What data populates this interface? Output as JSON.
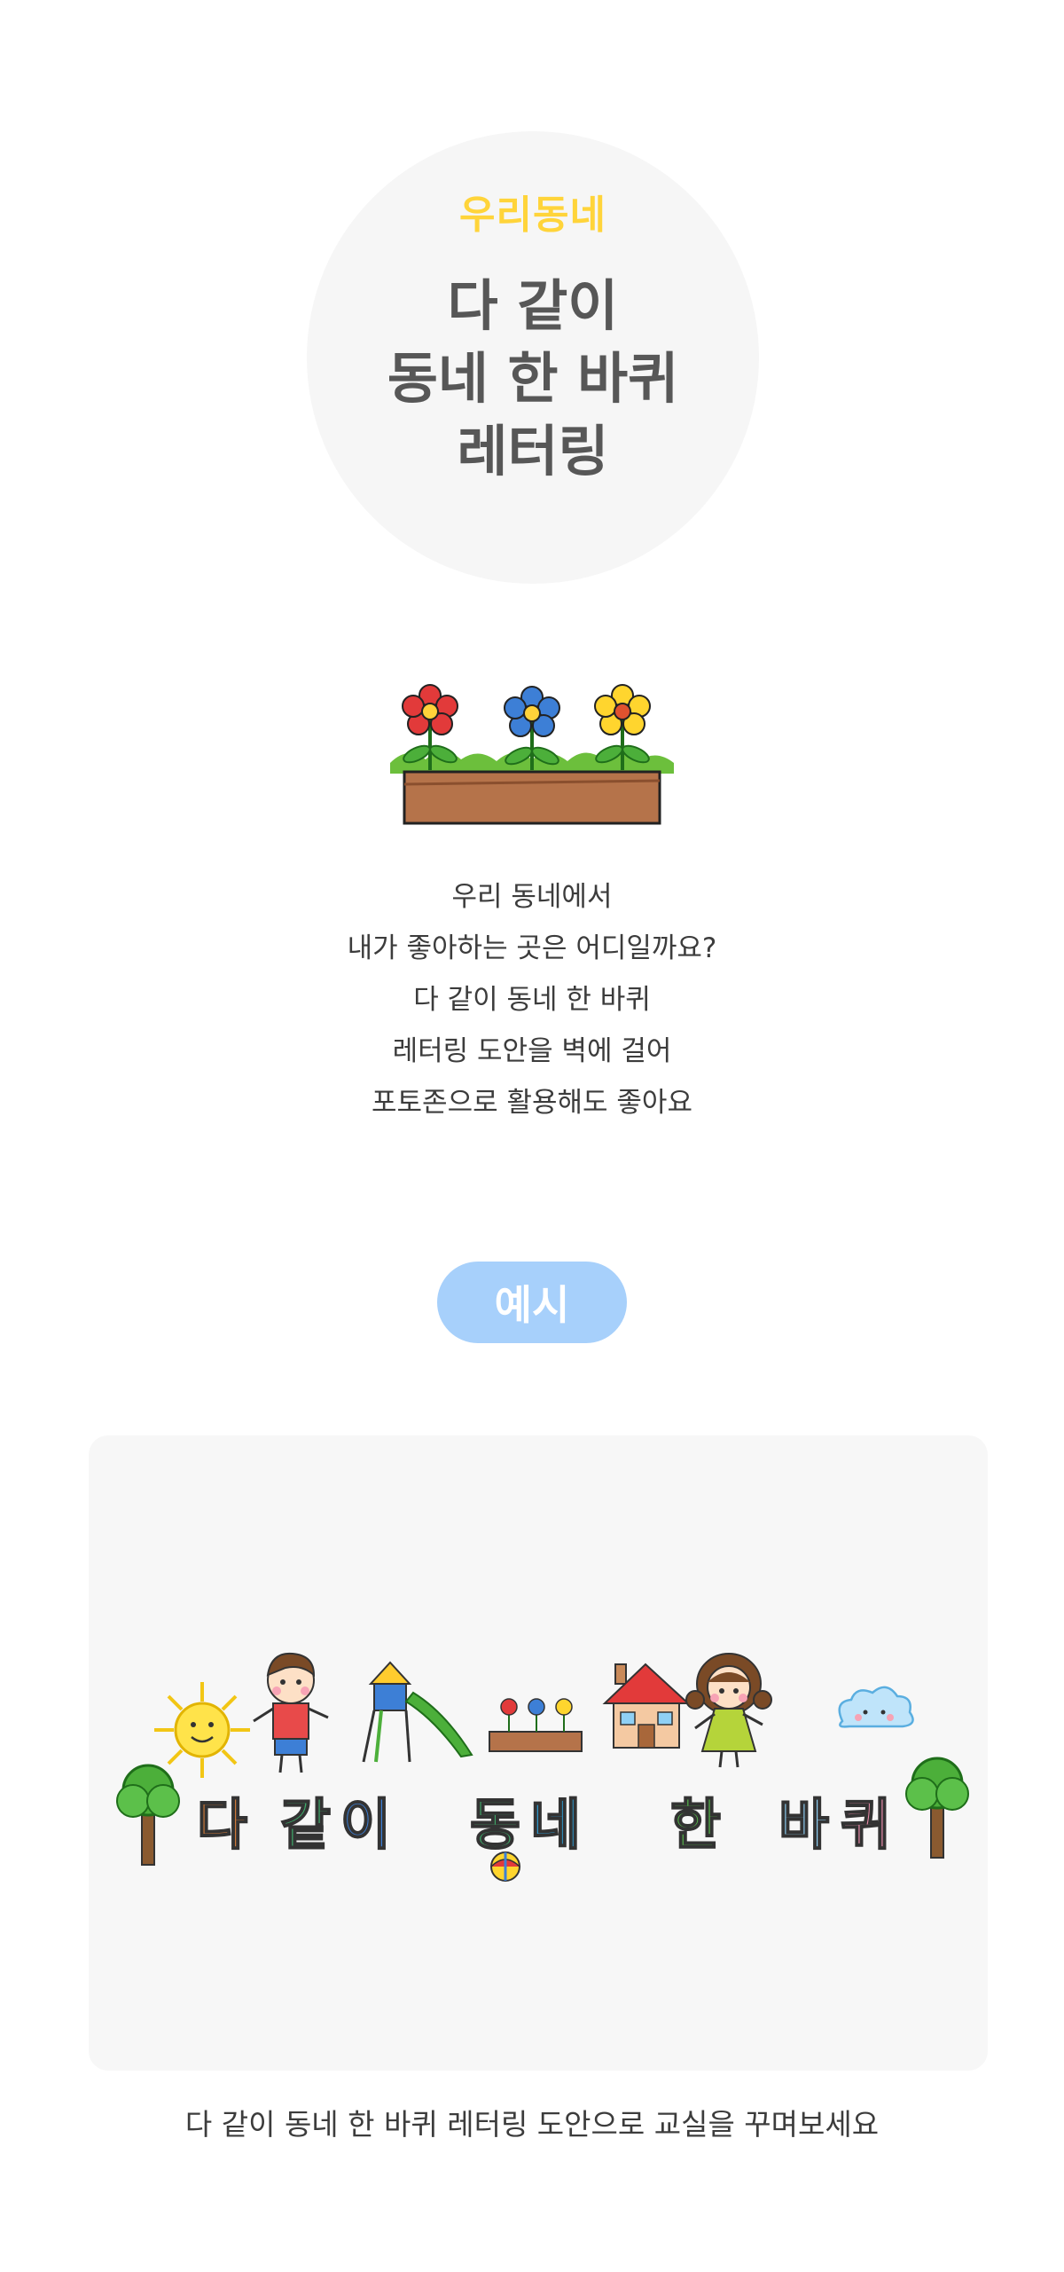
{
  "hero": {
    "subtitle": "우리동네",
    "title_lines": [
      "다 같이",
      "동네 한 바퀴",
      "레터링"
    ]
  },
  "description": {
    "lines": [
      "우리 동네에서",
      "내가 좋아하는 곳은 어디일까요?",
      "다 같이 동네 한 바퀴",
      "레터링 도안을 벽에 걸어",
      "포토존으로 활용해도 좋아요"
    ]
  },
  "example": {
    "label": "예시",
    "lettering": [
      "다",
      "같",
      "이",
      "동",
      "네",
      "한",
      "바",
      "퀴"
    ]
  },
  "caption": "다 같이 동네 한 바퀴 레터링 도안으로 교실을 꾸며보세요",
  "colors": {
    "accent_yellow": "#ffd43a",
    "pill_blue": "#a7d0fb",
    "title_gray": "#575757",
    "panel_bg": "#f7f7f7"
  }
}
